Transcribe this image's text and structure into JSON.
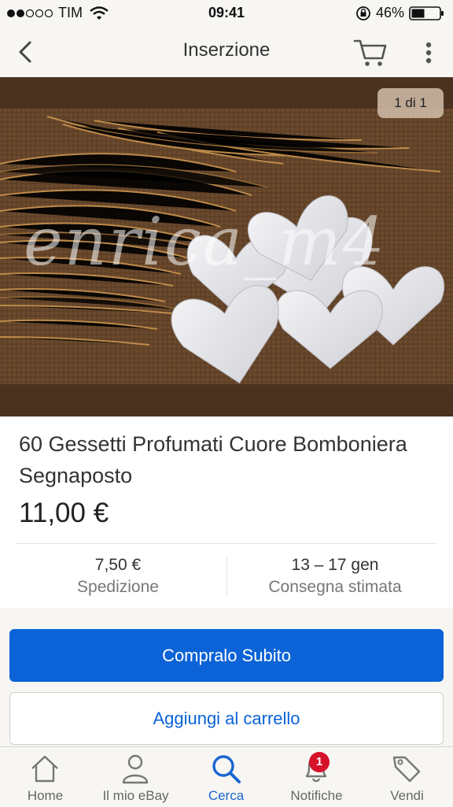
{
  "status": {
    "carrier": "TIM",
    "time": "09:41",
    "battery": "46%",
    "signal_dots": 5,
    "signal_filled": 2
  },
  "nav": {
    "title": "Inserzione"
  },
  "gallery": {
    "counter": "1 di 1",
    "watermark": "enrica_m4"
  },
  "listing": {
    "title": "60 Gessetti Profumati Cuore Bomboniera Segnaposto",
    "price": "11,00 €",
    "shipping_value": "7,50 €",
    "shipping_label": "Spedizione",
    "delivery_value": "13 – 17 gen",
    "delivery_label": "Consegna stimata"
  },
  "actions": {
    "buy_now": "Compralo Subito",
    "add_to_cart": "Aggiungi al carrello"
  },
  "tabs": [
    {
      "label": "Home",
      "icon": "home-icon"
    },
    {
      "label": "Il mio eBay",
      "icon": "user-icon"
    },
    {
      "label": "Cerca",
      "icon": "search-icon",
      "active": true
    },
    {
      "label": "Notifiche",
      "icon": "bell-icon",
      "badge": "1"
    },
    {
      "label": "Vendi",
      "icon": "tag-icon"
    }
  ],
  "colors": {
    "accent": "#0b63d7",
    "badge": "#d6112a",
    "bar": "#f7f6f3"
  }
}
